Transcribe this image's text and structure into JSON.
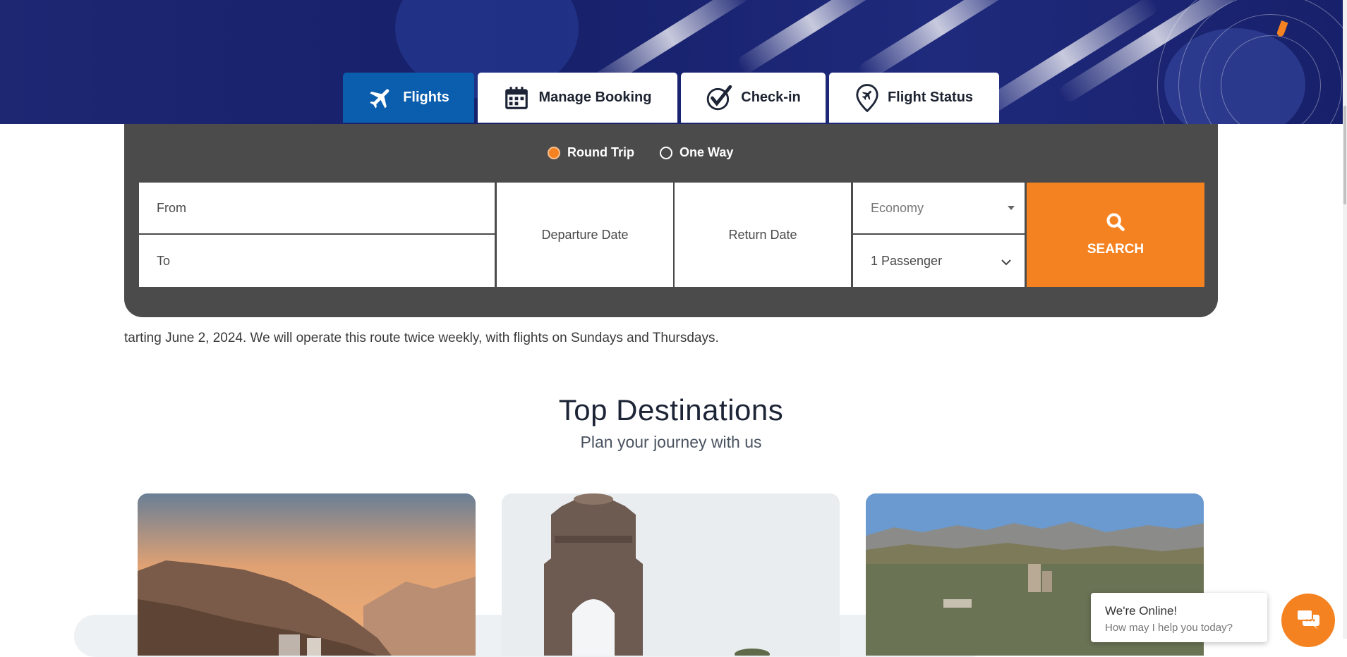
{
  "tabs": [
    {
      "label": "Flights",
      "icon": "plane-icon",
      "active": true
    },
    {
      "label": "Manage Booking",
      "icon": "calendar-icon",
      "active": false
    },
    {
      "label": "Check-in",
      "icon": "checkmark-icon",
      "active": false
    },
    {
      "label": "Flight Status",
      "icon": "location-plane-icon",
      "active": false
    }
  ],
  "trip_type": {
    "round_trip": "Round Trip",
    "one_way": "One Way",
    "selected": "Round Trip"
  },
  "form": {
    "from": "From",
    "to": "To",
    "departure_date": "Departure Date",
    "return_date": "Return Date",
    "cabin_class": "Economy",
    "passengers": "1 Passenger",
    "search_label": "SEARCH"
  },
  "notice_text": "tarting June 2, 2024. We will operate this route twice weekly, with flights on Sundays and Thursdays.",
  "destinations": {
    "title": "Top Destinations",
    "subtitle": "Plan your journey with us"
  },
  "chat": {
    "status": "We're Online!",
    "prompt": "How may I help you today?"
  },
  "colors": {
    "brand_blue": "#0b5ead",
    "accent_orange": "#f58220",
    "panel_gray": "#4b4b4b",
    "hero_navy": "#1d2772"
  }
}
